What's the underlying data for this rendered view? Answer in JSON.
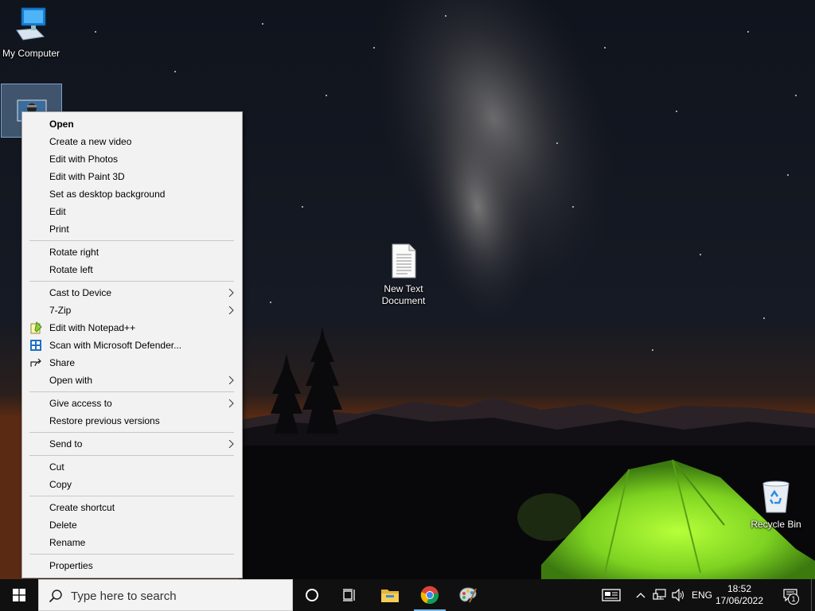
{
  "desktop": {
    "icons": [
      {
        "label": "My Computer",
        "icon": "computer-icon"
      },
      {
        "label": "",
        "icon": "image-file-icon",
        "selected": true
      },
      {
        "label": "New Text\nDocument",
        "icon": "text-document-icon"
      },
      {
        "label": "Recycle Bin",
        "icon": "recycle-bin-icon"
      }
    ]
  },
  "context_menu": {
    "items": [
      {
        "label": "Open",
        "bold": true
      },
      {
        "label": "Create a new video"
      },
      {
        "label": "Edit with Photos"
      },
      {
        "label": "Edit with Paint 3D"
      },
      {
        "label": "Set as desktop background"
      },
      {
        "label": "Edit"
      },
      {
        "label": "Print"
      },
      {
        "label": "Rotate right"
      },
      {
        "label": "Rotate left"
      },
      {
        "label": "Cast to Device",
        "submenu": true
      },
      {
        "label": "7-Zip",
        "submenu": true
      },
      {
        "label": "Edit with Notepad++",
        "icon": "notepad-plus-plus-icon"
      },
      {
        "label": "Scan with Microsoft Defender...",
        "icon": "defender-shield-icon"
      },
      {
        "label": "Share",
        "icon": "share-icon"
      },
      {
        "label": "Open with",
        "submenu": true
      },
      {
        "label": "Give access to",
        "submenu": true
      },
      {
        "label": "Restore previous versions"
      },
      {
        "label": "Send to",
        "submenu": true
      },
      {
        "label": "Cut"
      },
      {
        "label": "Copy"
      },
      {
        "label": "Create shortcut"
      },
      {
        "label": "Delete"
      },
      {
        "label": "Rename"
      },
      {
        "label": "Properties"
      }
    ]
  },
  "taskbar": {
    "search_placeholder": "Type here to search",
    "apps": [
      {
        "name": "cortana",
        "icon": "cortana-circle-icon"
      },
      {
        "name": "task-view",
        "icon": "task-view-icon"
      },
      {
        "name": "file-explorer",
        "icon": "folder-icon"
      },
      {
        "name": "chrome",
        "icon": "chrome-icon",
        "active": true
      },
      {
        "name": "paint",
        "icon": "paint-palette-icon"
      }
    ],
    "tray": {
      "language": "ENG",
      "time": "18:52",
      "date": "17/06/2022",
      "notification_count": "1"
    }
  },
  "colors": {
    "taskbar_bg": "#101010",
    "menu_bg": "#f2f2f2",
    "accent": "#76b9ed",
    "tent_green": "#8fe02a"
  }
}
